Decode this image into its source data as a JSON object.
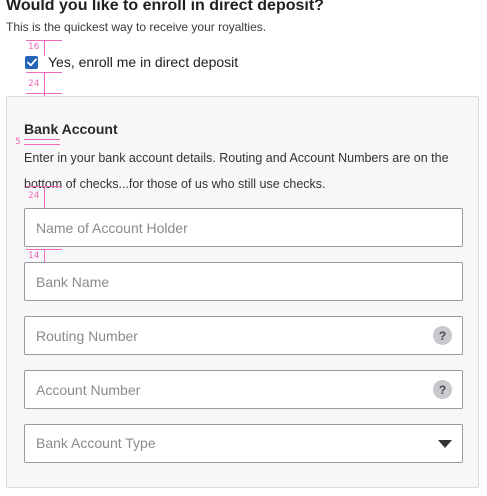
{
  "header": {
    "question": "Would you like to enroll in direct deposit?",
    "subtitle": "This is the quickest way to receive your royalties."
  },
  "enroll": {
    "label": "Yes, enroll me in direct deposit",
    "checked": true,
    "accent_color": "#2563b8"
  },
  "annotations": {
    "color": "#f06ab8",
    "spacing": [
      "16",
      "24",
      "5",
      "24",
      "14"
    ]
  },
  "bank_account": {
    "title": "Bank Account",
    "description": "Enter in your bank account details. Routing and Account Numbers are on the bottom of checks...for those of us who still use checks.",
    "fields": {
      "holder_placeholder": "Name of Account Holder",
      "bank_name_placeholder": "Bank Name",
      "routing_placeholder": "Routing Number",
      "account_number_placeholder": "Account Number",
      "account_type_placeholder": "Bank Account Type"
    },
    "help_glyph": "?"
  }
}
